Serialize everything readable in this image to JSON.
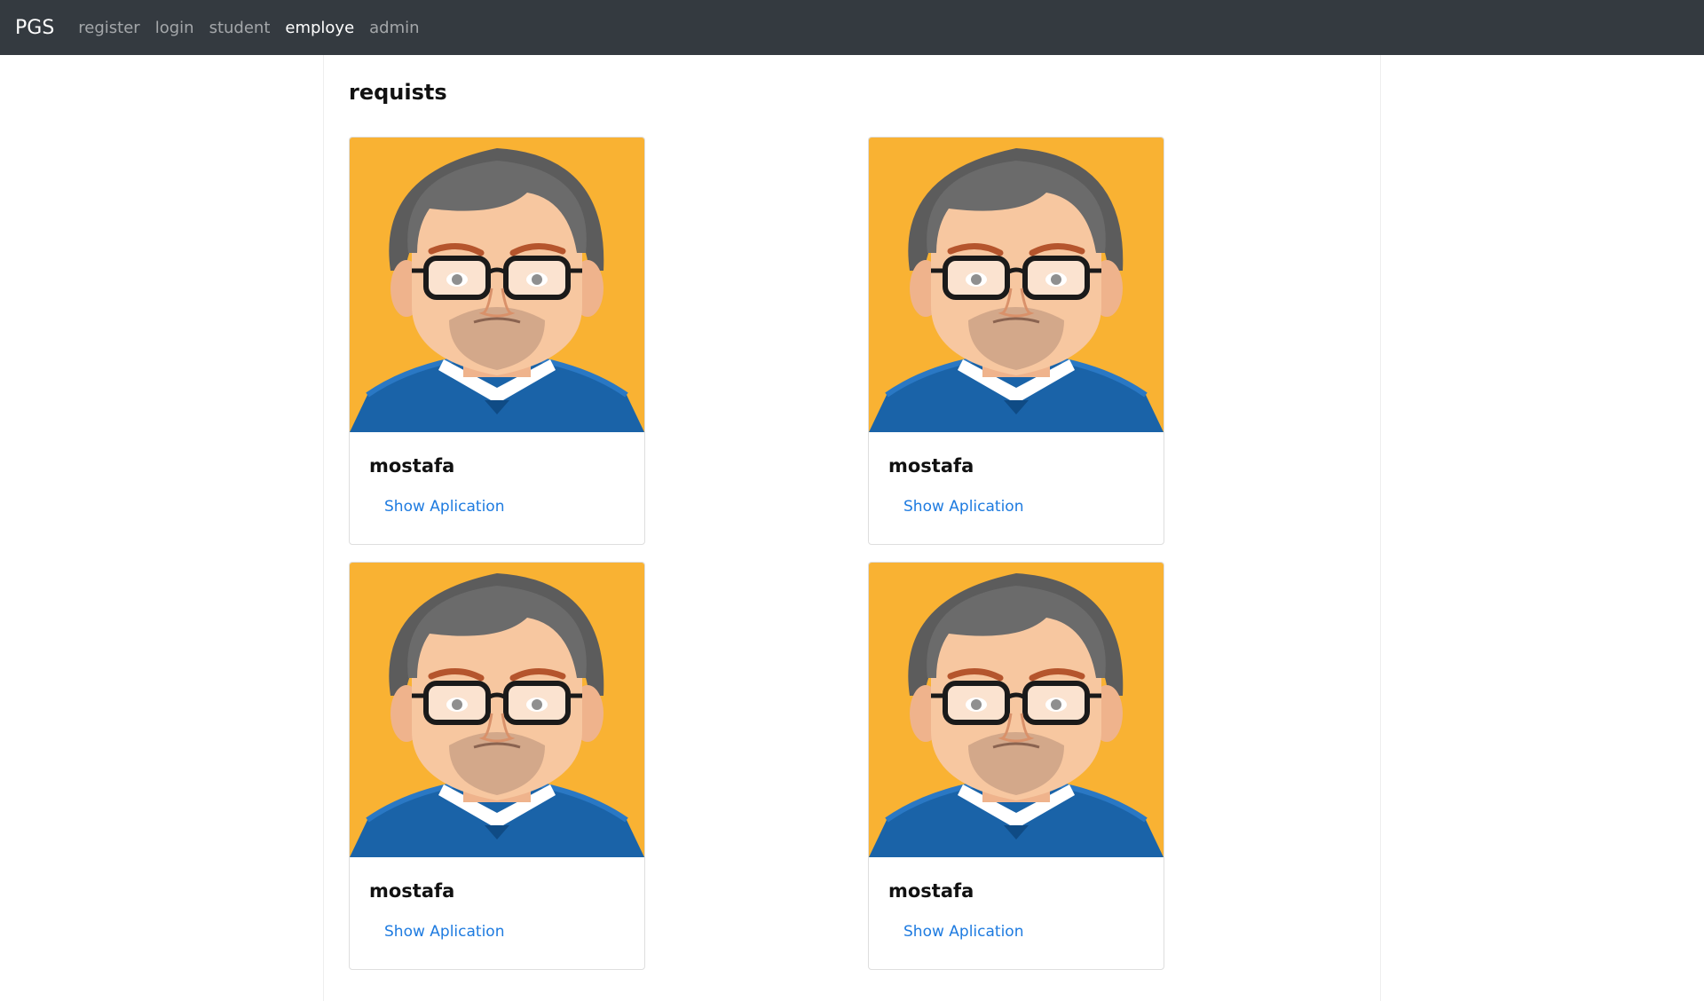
{
  "navbar": {
    "brand": "PGS",
    "links": [
      {
        "label": "register",
        "active": false
      },
      {
        "label": "login",
        "active": false
      },
      {
        "label": "student",
        "active": false
      },
      {
        "label": "employe",
        "active": true
      },
      {
        "label": "admin",
        "active": false
      }
    ]
  },
  "page": {
    "title": "requists"
  },
  "cards": [
    {
      "name": "mostafa",
      "link_label": "Show Aplication"
    },
    {
      "name": "mostafa",
      "link_label": "Show Aplication"
    },
    {
      "name": "mostafa",
      "link_label": "Show Aplication"
    },
    {
      "name": "mostafa",
      "link_label": "Show Aplication"
    }
  ],
  "colors": {
    "navbar_bg": "#343a40",
    "avatar_bg": "#f9b233",
    "link": "#1e7be0"
  },
  "icons": {
    "avatar": "cartoon-man-with-glasses-avatar"
  }
}
